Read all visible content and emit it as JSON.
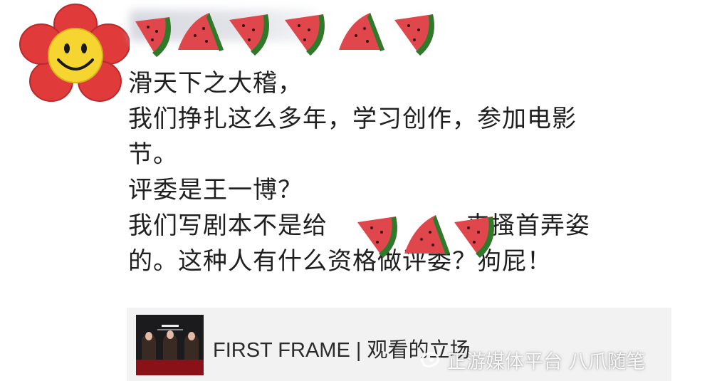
{
  "post": {
    "lines": [
      "滑天下之大稽，",
      "我们挣扎这么多年，学习创作，参加电影",
      "节。",
      "评委是王一博？",
      "我们写剧本不是给",
      "的。这种人有什么资格做评委？狗屁！"
    ],
    "line5_tail": "来搔首弄姿"
  },
  "link_card": {
    "title": "FIRST FRAME | 观看的立场"
  },
  "watermark": {
    "text": "正游媒体平台 八爪随笔"
  },
  "colors": {
    "melon_red": "#e0474c",
    "melon_rind": "#2f7a2a",
    "flower_red": "#e03a3a",
    "smiley_yellow": "#f6d531"
  },
  "icons": {
    "avatar": "smiley-flower-icon",
    "emoji": "watermelon-icon"
  }
}
